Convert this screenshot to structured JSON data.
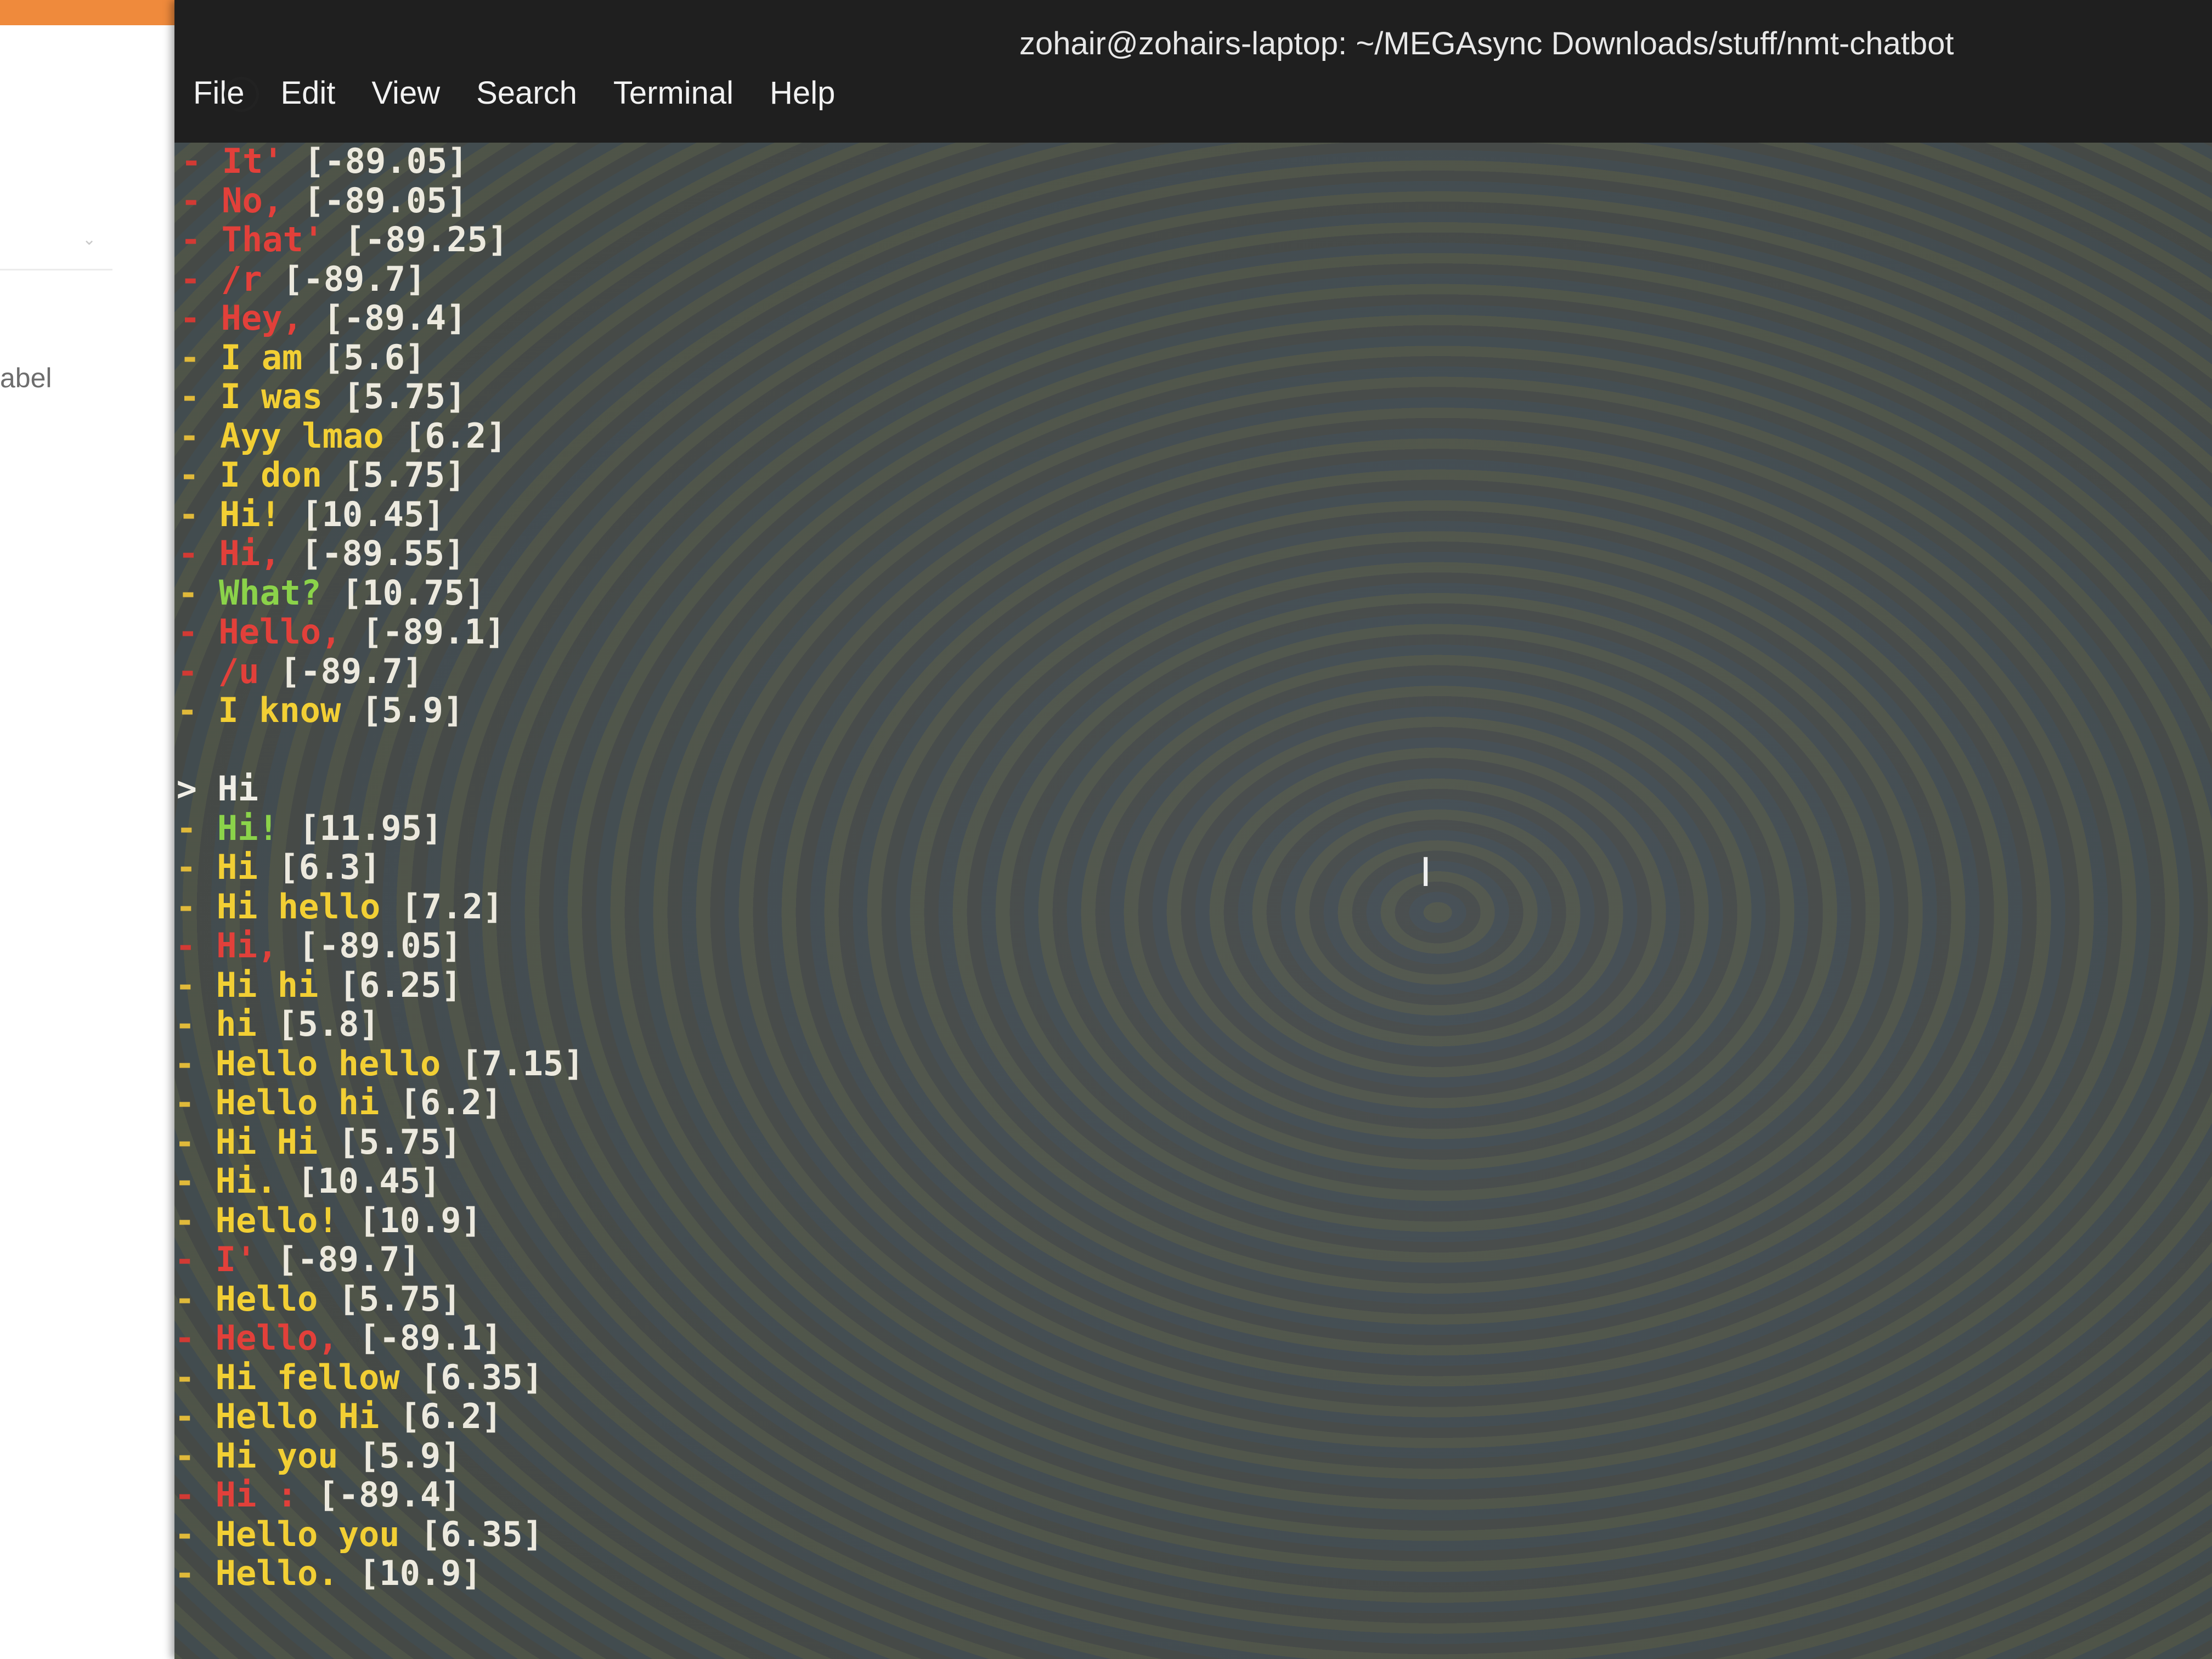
{
  "background_page": {
    "label_fragment": "abel"
  },
  "window": {
    "title": "zohair@zohairs-laptop: ~/MEGAsync Downloads/stuff/nmt-chatbot"
  },
  "menu": [
    {
      "label": "File"
    },
    {
      "label": "Edit"
    },
    {
      "label": "View"
    },
    {
      "label": "Search"
    },
    {
      "label": "Terminal"
    },
    {
      "label": "Help"
    }
  ],
  "terminal": {
    "lines_before": [
      {
        "text": "It'",
        "score": "[-89.05]",
        "color": "red"
      },
      {
        "text": "No,",
        "score": "[-89.05]",
        "color": "red"
      },
      {
        "text": "That'",
        "score": "[-89.25]",
        "color": "red"
      },
      {
        "text": "/r",
        "score": "[-89.7]",
        "color": "red"
      },
      {
        "text": "Hey,",
        "score": "[-89.4]",
        "color": "red"
      },
      {
        "text": "I am",
        "score": "[5.6]",
        "color": "yellow"
      },
      {
        "text": "I was",
        "score": "[5.75]",
        "color": "yellow"
      },
      {
        "text": "Ayy lmao",
        "score": "[6.2]",
        "color": "yellow"
      },
      {
        "text": "I don",
        "score": "[5.75]",
        "color": "yellow"
      },
      {
        "text": "Hi!",
        "score": "[10.45]",
        "color": "yellow"
      },
      {
        "text": "Hi,",
        "score": "[-89.55]",
        "color": "red"
      },
      {
        "text": "What?",
        "score": "[10.75]",
        "color": "green"
      },
      {
        "text": "Hello,",
        "score": "[-89.1]",
        "color": "red"
      },
      {
        "text": "/u",
        "score": "[-89.7]",
        "color": "red"
      },
      {
        "text": "I know",
        "score": "[5.9]",
        "color": "yellow"
      }
    ],
    "prompt": "> Hi",
    "lines_after": [
      {
        "text": "Hi!",
        "score": "[11.95]",
        "color": "green"
      },
      {
        "text": "Hi",
        "score": "[6.3]",
        "color": "yellow"
      },
      {
        "text": "Hi hello",
        "score": "[7.2]",
        "color": "yellow"
      },
      {
        "text": "Hi,",
        "score": "[-89.05]",
        "color": "red"
      },
      {
        "text": "Hi hi",
        "score": "[6.25]",
        "color": "yellow"
      },
      {
        "text": "hi",
        "score": "[5.8]",
        "color": "yellow"
      },
      {
        "text": "Hello hello",
        "score": "[7.15]",
        "color": "yellow"
      },
      {
        "text": "Hello hi",
        "score": "[6.2]",
        "color": "yellow"
      },
      {
        "text": "Hi Hi",
        "score": "[5.75]",
        "color": "yellow"
      },
      {
        "text": "Hi.",
        "score": "[10.45]",
        "color": "yellow"
      },
      {
        "text": "Hello!",
        "score": "[10.9]",
        "color": "yellow"
      },
      {
        "text": "I'",
        "score": "[-89.7]",
        "color": "red"
      },
      {
        "text": "Hello",
        "score": "[5.75]",
        "color": "yellow"
      },
      {
        "text": "Hello,",
        "score": "[-89.1]",
        "color": "red"
      },
      {
        "text": "Hi fellow",
        "score": "[6.35]",
        "color": "yellow"
      },
      {
        "text": "Hello Hi",
        "score": "[6.2]",
        "color": "yellow"
      },
      {
        "text": "Hi you",
        "score": "[5.9]",
        "color": "yellow"
      },
      {
        "text": "Hi :",
        "score": "[-89.4]",
        "color": "red"
      },
      {
        "text": "Hello you",
        "score": "[6.35]",
        "color": "yellow"
      },
      {
        "text": "Hello.",
        "score": "[10.9]",
        "color": "yellow"
      }
    ]
  },
  "colors": {
    "accent_orange": "#ef8a3c",
    "terminal_bg": "#424a47",
    "titlebar_bg": "#1f1f1f",
    "red": "#e2403a",
    "yellow": "#f2cf34",
    "green": "#8bd34a"
  },
  "icons": {
    "text_cursor": "text-cursor-icon",
    "pointer": "pointer-circle-icon"
  }
}
